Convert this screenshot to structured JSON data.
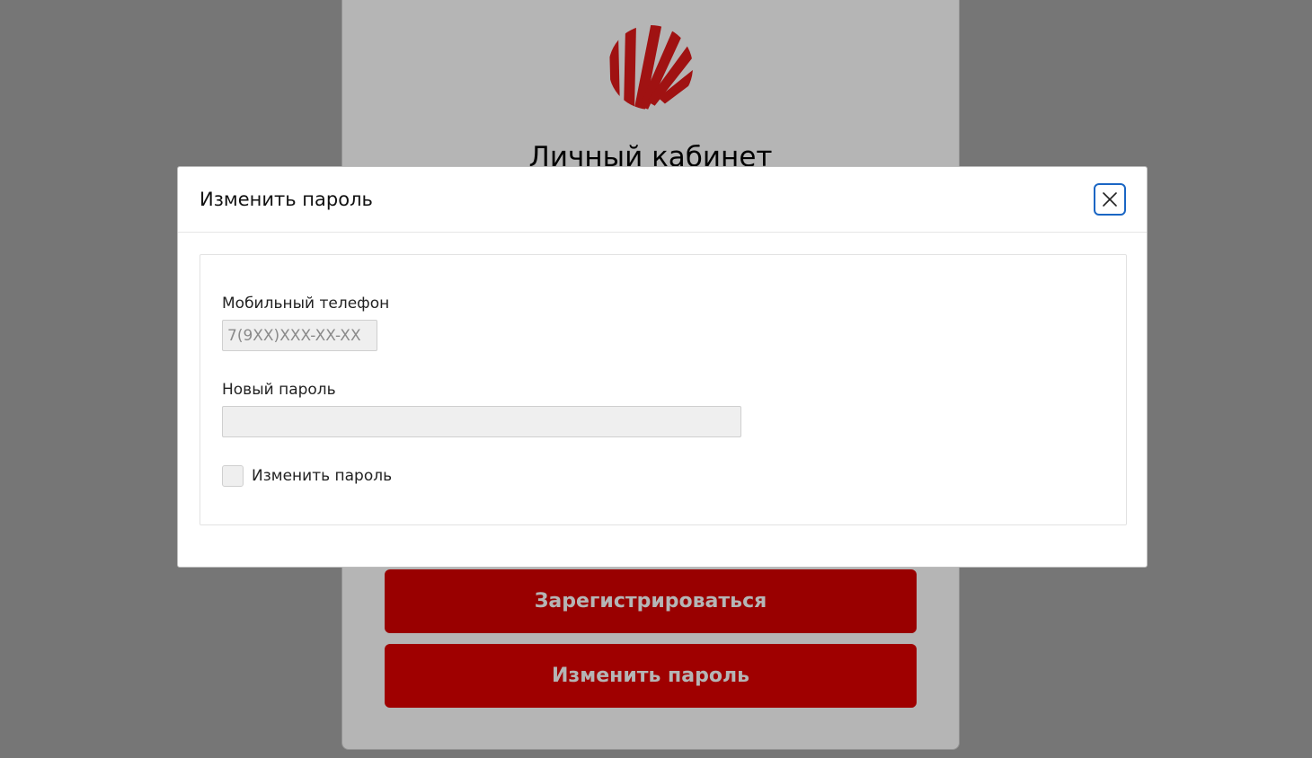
{
  "background": {
    "title": "Личный кабинет",
    "buttons": {
      "register_label": "Зарегистрироваться",
      "change_password_label": "Изменить пароль"
    },
    "logo_icon": "red-striped-circle-logo",
    "accent_color": "#e00000"
  },
  "modal": {
    "title": "Изменить пароль",
    "close_icon": "close-icon",
    "fields": {
      "phone_label": "Мобильный телефон",
      "phone_placeholder": "7(9XX)XXX-XX-XX",
      "phone_value": "",
      "password_label": "Новый пароль",
      "password_value": ""
    },
    "checkbox": {
      "label": "Изменить пароль",
      "checked": false
    },
    "focus_color": "#1a66c4"
  }
}
